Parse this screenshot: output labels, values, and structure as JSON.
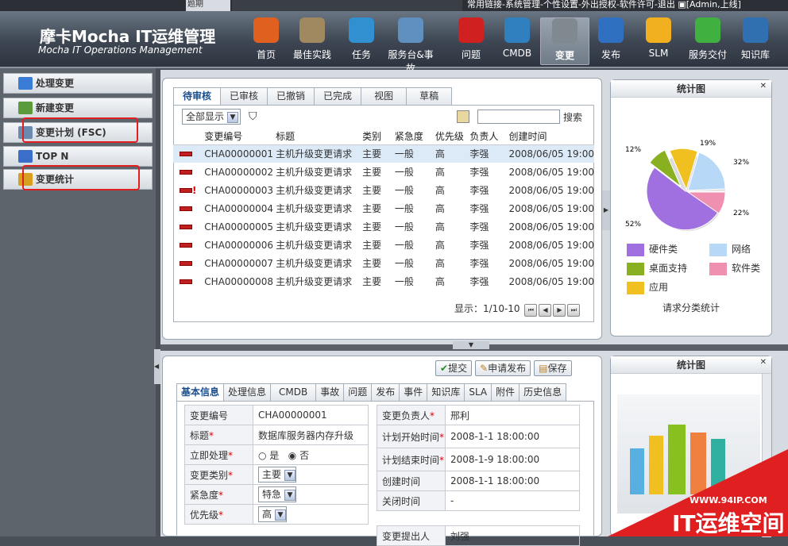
{
  "topbar": {
    "crumb": "题期",
    "links": "常用链接-系统管理-个性设置-外出授权-软件许可-退出",
    "user": "[Admin,上线]"
  },
  "brand": {
    "name_cn": "摩卡Mocha IT运维管理",
    "name_en": "Mocha IT Operations Management"
  },
  "nav": [
    {
      "label": "首页",
      "icon": "home-icon"
    },
    {
      "label": "最佳实践",
      "icon": "book-icon"
    },
    {
      "label": "任务",
      "icon": "task-icon"
    },
    {
      "label": "服务台&事故",
      "icon": "monitor-icon"
    },
    {
      "label": "问题",
      "icon": "question-icon"
    },
    {
      "label": "CMDB",
      "icon": "database-icon"
    },
    {
      "label": "变更",
      "icon": "change-icon",
      "active": true
    },
    {
      "label": "发布",
      "icon": "release-icon"
    },
    {
      "label": "SLM",
      "icon": "clipboard-icon"
    },
    {
      "label": "服务交付",
      "icon": "delivery-icon"
    },
    {
      "label": "知识库",
      "icon": "books-icon"
    }
  ],
  "sidebar": [
    {
      "label": "处理变更",
      "icon": "search-icon",
      "color": "#3a7bd5"
    },
    {
      "label": "新建变更",
      "icon": "new-icon",
      "color": "#5a9a3a"
    },
    {
      "label": "变更计划 (FSC)",
      "icon": "calendar-icon",
      "color": "#6a8ab0",
      "highlight": true
    },
    {
      "label": "TOP N",
      "icon": "topn-icon",
      "color": "#3a6ec8"
    },
    {
      "label": "变更统计",
      "icon": "stats-icon",
      "color": "#d8a020",
      "highlight": true
    }
  ],
  "list": {
    "tabs": [
      "待审核",
      "已审核",
      "已撤销",
      "已完成",
      "视图",
      "草稿"
    ],
    "filter": "全部显示",
    "search_placeholder": "",
    "search_label": "搜索",
    "columns": [
      "变更编号",
      "标题",
      "类别",
      "紧急度",
      "优先级",
      "负责人",
      "创建时间"
    ],
    "rows": [
      [
        "CHA00000001",
        "主机升级变更请求",
        "主要",
        "一般",
        "高",
        "李强",
        "2008/06/05 19:00"
      ],
      [
        "CHA00000002",
        "主机升级变更请求",
        "主要",
        "一般",
        "高",
        "李强",
        "2008/06/05 19:00"
      ],
      [
        "CHA00000003",
        "主机升级变更请求",
        "主要",
        "一般",
        "高",
        "李强",
        "2008/06/05 19:00"
      ],
      [
        "CHA00000004",
        "主机升级变更请求",
        "主要",
        "一般",
        "高",
        "李强",
        "2008/06/05 19:00"
      ],
      [
        "CHA00000005",
        "主机升级变更请求",
        "主要",
        "一般",
        "高",
        "李强",
        "2008/06/05 19:00"
      ],
      [
        "CHA00000006",
        "主机升级变更请求",
        "主要",
        "一般",
        "高",
        "李强",
        "2008/06/05 19:00"
      ],
      [
        "CHA00000007",
        "主机升级变更请求",
        "主要",
        "一般",
        "高",
        "李强",
        "2008/06/05 19:00"
      ],
      [
        "CHA00000008",
        "主机升级变更请求",
        "主要",
        "一般",
        "高",
        "李强",
        "2008/06/05 19:00"
      ]
    ],
    "pager": "显示：1/10-10"
  },
  "stats1": {
    "title": "统计图",
    "caption": "请求分类统计",
    "legend": [
      "硬件类",
      "网络",
      "桌面支持",
      "软件类",
      "应用"
    ],
    "colors": [
      "#a070e0",
      "#b8d8f8",
      "#88b020",
      "#f090b0",
      "#f0c020"
    ],
    "labels": [
      "52%",
      "12%",
      "19%",
      "32%",
      "22%"
    ]
  },
  "stats2": {
    "title": "统计图"
  },
  "form": {
    "actions": [
      "提交",
      "申请发布",
      "保存"
    ],
    "tabs": [
      "基本信息",
      "处理信息",
      "CMDB",
      "事故",
      "问题",
      "发布",
      "事件",
      "知识库",
      "SLA",
      "附件",
      "历史信息"
    ],
    "left": {
      "id_label": "变更编号",
      "id": "CHA00000001",
      "title_label": "标题",
      "title": "数据库服务器内存升级",
      "now_label": "立即处理",
      "yes": "是",
      "no": "否",
      "type_label": "变更类别",
      "type": "主要",
      "urg_label": "紧急度",
      "urg": "特急",
      "pri_label": "优先级",
      "pri": "高"
    },
    "right": {
      "owner_label": "变更负责人",
      "owner": "邢利",
      "start_label": "计划开始时间",
      "start": "2008-1-1 18:00:00",
      "end_label": "计划结束时间",
      "end": "2008-1-9 18:00:00",
      "created_label": "创建时间",
      "created": "2008-1-1 18:00:00",
      "closed_label": "关闭时间",
      "closed": "-",
      "submitter_label": "变更提出人",
      "submitter": "刘强"
    }
  },
  "watermark": {
    "url": "WWW.94IP.COM",
    "text": "IT运维空间"
  }
}
